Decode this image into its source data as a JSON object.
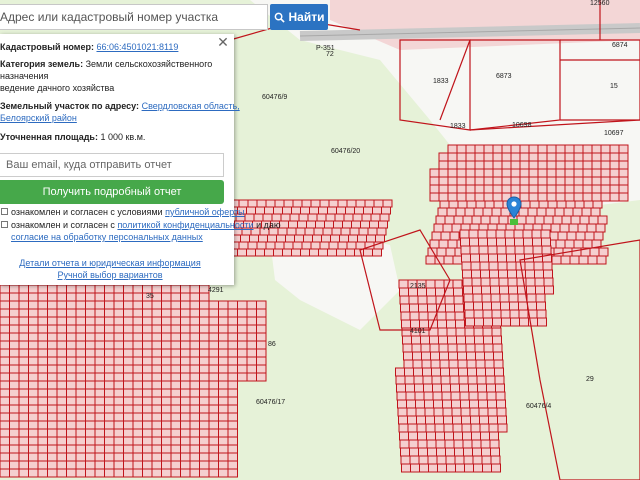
{
  "search": {
    "placeholder": "Адрес или кадастровый номер участка",
    "button_label": "Найти"
  },
  "panel": {
    "cadastral_label": "Кадастровый номер:",
    "cadastral_number": "66:06:4501021:8119",
    "category_label": "Категория земель:",
    "category_value_1": "Земли сельскохозяйственного",
    "category_value_2": "назначения",
    "usage": "ведение дачного хозяйства",
    "address_label": "Земельный участок по адресу:",
    "address_link_1": "Свердловская область,",
    "address_link_2": "Белоярский район",
    "area_label": "Уточненная площадь:",
    "area_value": "1 000 кв.м.",
    "email_placeholder": "Ваш email, куда отправить отчет",
    "report_button": "Получить подробный отчет",
    "consent1_text": "ознакомлен и согласен с условиями",
    "consent1_link": "публичной оферты",
    "consent2_text_1": "ознакомлен и согласен с",
    "consent2_link_1": "политикой конфиденциальности",
    "consent2_text_2": "и даю",
    "consent2_link_2": "согласие на обработку персональных данных",
    "link_details": "Детали отчета и юридическая информация",
    "link_manual": "Ручной выбор вариантов"
  },
  "map": {
    "labels": [
      "12560",
      "P-351",
      "72",
      "6874",
      "6873",
      "15",
      "60476/9",
      "1833",
      "1833",
      "10698",
      "10697",
      "60476/20",
      "4291",
      "2135",
      "4101",
      "60476/17",
      "60476/4",
      "29",
      "86",
      "35"
    ],
    "colors": {
      "land": "#e6f2d8",
      "plot_fill": "#f5cfcf",
      "boundary": "#c0141b",
      "road": "#c8c8c8"
    }
  }
}
